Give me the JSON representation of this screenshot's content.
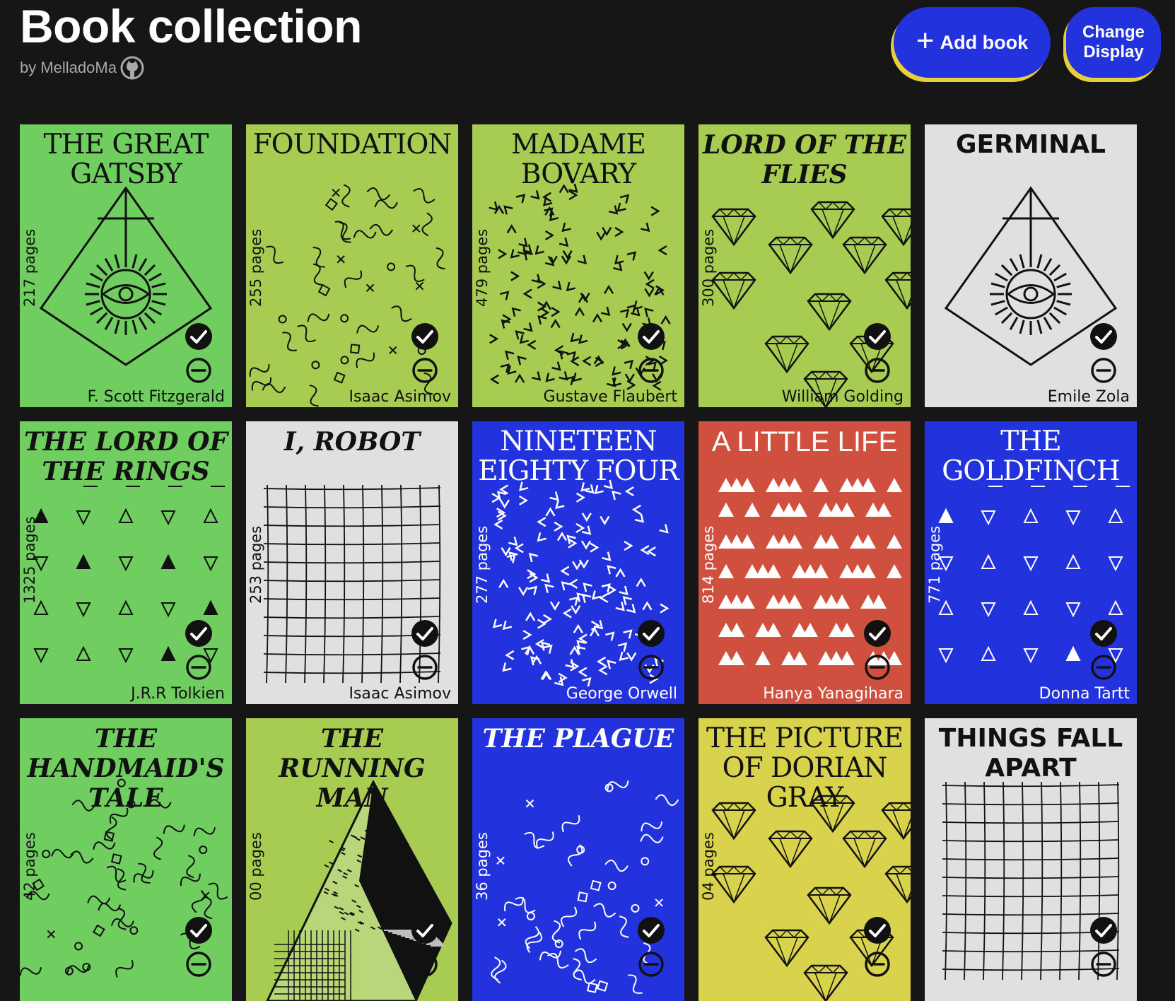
{
  "header": {
    "title": "Book collection",
    "byline": "by MelladoMa",
    "github_icon": "github-icon"
  },
  "toolbar": {
    "add_label": "Add book",
    "add_icon": "plus-icon",
    "display_label": "Change Display"
  },
  "colors": {
    "background": "#161616",
    "button": "#2233dd",
    "button_shadow": "#e7cf3a",
    "green": "#6fce5f",
    "lime": "#a8cc52",
    "grey": "#e0e0e0",
    "blue": "#2233dd",
    "red": "#cf503e",
    "yellow": "#d9d24d"
  },
  "books": [
    {
      "title": "THE GREAT GATSBY",
      "author": "F. Scott Fitzgerald",
      "pages": "217 pages",
      "art": "eye-pyramid",
      "color": "#6fce5f"
    },
    {
      "title": "FOUNDATION",
      "author": "Isaac Asimov",
      "pages": "255 pages",
      "art": "squiggles",
      "color": "#a8cc52"
    },
    {
      "title": "MADAME BOVARY",
      "author": "Gustave Flaubert",
      "pages": "479 pages",
      "art": "chevrons",
      "color": "#a8cc52"
    },
    {
      "title": "LORD OF THE FLIES",
      "author": "William Golding",
      "pages": "300 pages",
      "art": "diamonds",
      "color": "#a8cc52"
    },
    {
      "title": "GERMINAL",
      "author": "Emile Zola",
      "pages": "",
      "art": "eye-pyramid",
      "color": "#e0e0e0"
    },
    {
      "title": "THE LORD OF THE RINGS",
      "author": "J.R.R Tolkien",
      "pages": "1325 pages",
      "art": "triangles",
      "color": "#6fce5f"
    },
    {
      "title": "I, ROBOT",
      "author": "Isaac Asimov",
      "pages": "253 pages",
      "art": "grid",
      "color": "#e0e0e0"
    },
    {
      "title": "NINETEEN EIGHTY FOUR",
      "author": "George Orwell",
      "pages": "277 pages",
      "art": "chevrons",
      "color": "#2233dd"
    },
    {
      "title": "A LITTLE LIFE",
      "author": "Hanya Yanagihara",
      "pages": "814 pages",
      "art": "mountains",
      "color": "#cf503e"
    },
    {
      "title": "THE GOLDFINCH",
      "author": "Donna Tartt",
      "pages": "771 pages",
      "art": "triangles",
      "color": "#2233dd"
    },
    {
      "title": "THE HANDMAID'S TALE",
      "author": "",
      "pages": "42 pages",
      "art": "squiggles",
      "color": "#6fce5f"
    },
    {
      "title": "THE RUNNING MAN",
      "author": "",
      "pages": "00 pages",
      "art": "pyramid",
      "color": "#a8cc52"
    },
    {
      "title": "THE PLAGUE",
      "author": "",
      "pages": "36 pages",
      "art": "squiggles",
      "color": "#2233dd"
    },
    {
      "title": "THE PICTURE OF DORIAN GRAY",
      "author": "",
      "pages": "04 pages",
      "art": "diamonds",
      "color": "#d9d24d"
    },
    {
      "title": "THINGS FALL APART",
      "author": "",
      "pages": "",
      "art": "grid",
      "color": "#e0e0e0"
    }
  ]
}
